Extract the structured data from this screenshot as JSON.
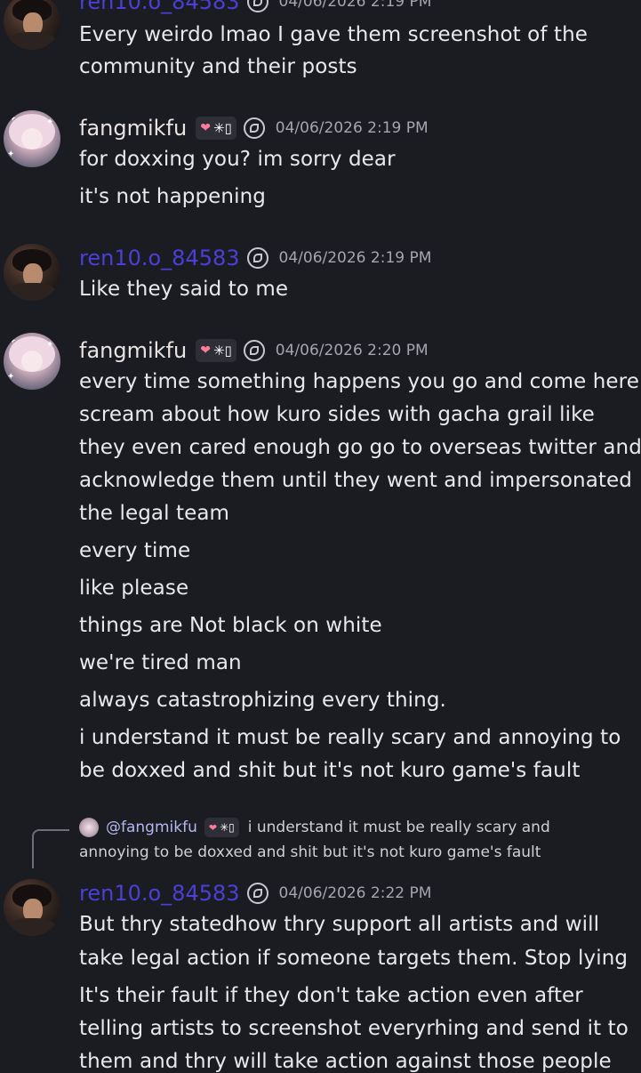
{
  "messages": [
    {
      "author": "ren10.o_84583",
      "timestamp": "04/06/2026 2:19 PM",
      "lines": [
        "Every weirdo lmao I gave them screenshot of the",
        "community and their posts"
      ]
    },
    {
      "author": "fangmikfu",
      "tag": "✳▯",
      "timestamp": "04/06/2026 2:19 PM",
      "lines": [
        "for doxxing you? im sorry dear",
        "it's not happening"
      ]
    },
    {
      "author": "ren10.o_84583",
      "timestamp": "04/06/2026 2:19 PM",
      "lines": [
        "Like they said to me"
      ]
    },
    {
      "author": "fangmikfu",
      "tag": "✳▯",
      "timestamp": "04/06/2026 2:20 PM",
      "lines": [
        "every time something happens you go and come here",
        "scream about how kuro sides with gacha grail like",
        "they even cared enough go go to overseas twitter and",
        "acknowledge them until they went and impersonated",
        "the legal team",
        "every time",
        "like please",
        "things are Not black on white",
        "we're tired man",
        "always catastrophizing every thing.",
        "i understand it must be really scary and annoying to",
        "be doxxed and shit but it's not kuro game's fault"
      ]
    },
    {
      "reply": {
        "mention": "@fangmikfu",
        "tag": "✳▯",
        "text_line1": "i understand it must be really scary and",
        "text_line2": "annoying to be doxxed and shit but it's not kuro game's fault"
      },
      "author": "ren10.o_84583",
      "timestamp": "04/06/2026 2:22 PM",
      "lines": [
        "But thry statedhow thry support all artists and will",
        "take legal action if someone targets them. Stop lying",
        "It's their fault if they don't take action even after",
        "telling artists to screenshot everyrhing and send it to",
        "them and thry will take action against those people"
      ]
    }
  ],
  "colors": {
    "background": "#1b1c22",
    "ren_name": "#4b3fd8",
    "text": "#e8e9ed",
    "timestamp": "#a4a6ae"
  },
  "icons": {
    "heart": "heart-icon",
    "role": "role-emblem-icon"
  }
}
